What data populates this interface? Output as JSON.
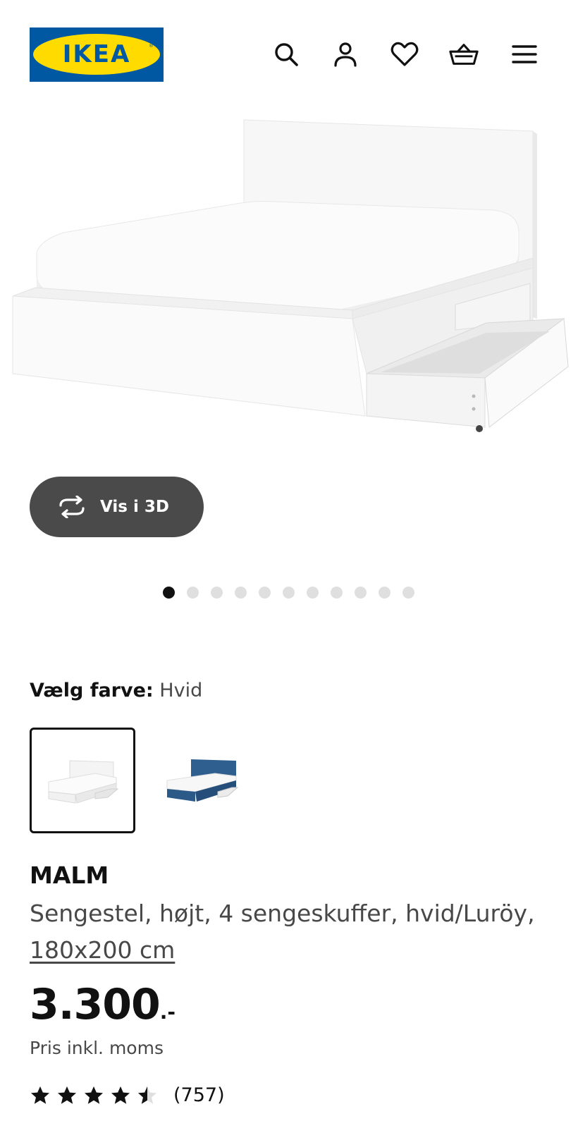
{
  "header": {
    "logo_text": "IKEA",
    "icons": [
      "search-icon",
      "account-icon",
      "heart-icon",
      "basket-icon",
      "menu-icon"
    ]
  },
  "viewer": {
    "btn_3d_label": "Vis i 3D",
    "total_images": 11,
    "active_index": 0
  },
  "color_select": {
    "label": "Vælg farve:",
    "value": "Hvid",
    "options": [
      "Hvid",
      "Luröy blue"
    ]
  },
  "product": {
    "name": "MALM",
    "description": "Sengestel, højt, 4 sengeskuffer, hvid/Luröy,",
    "size_link": "180x200 cm",
    "price": "3.300",
    "price_suffix": ".-",
    "price_note": "Pris inkl. moms",
    "rating": 4.5,
    "review_count": "(757)"
  },
  "colors": {
    "ikea_blue": "#0058a3",
    "ikea_yellow": "#ffdb00",
    "button_bg": "#4a4a4a",
    "swatch_blue": "#2e5f8f"
  }
}
